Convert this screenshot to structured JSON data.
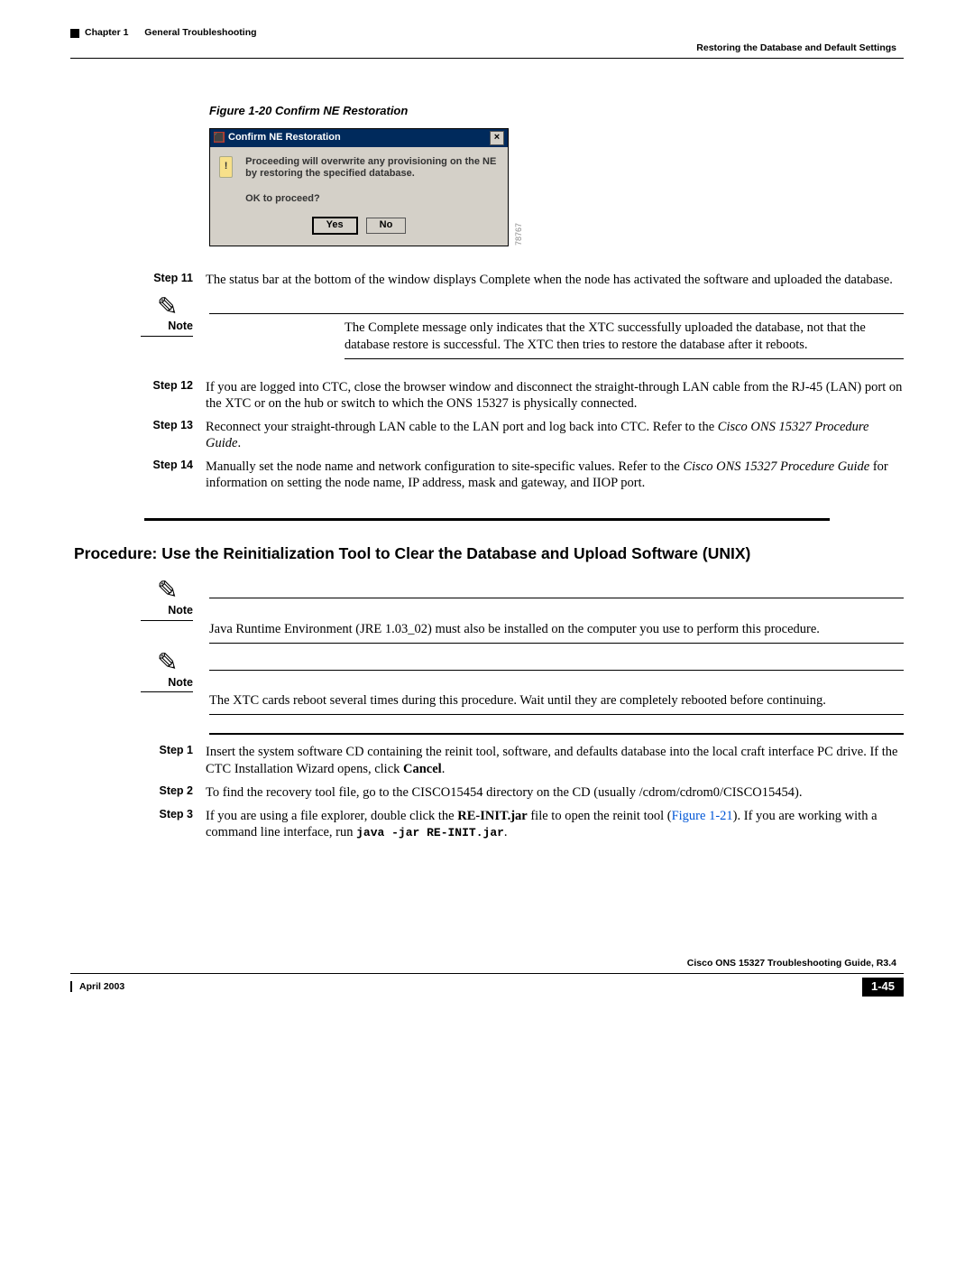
{
  "header": {
    "chapter_label": "Chapter 1",
    "chapter_title": "General Troubleshooting",
    "section": "Restoring the Database and Default Settings"
  },
  "figure": {
    "caption": "Figure 1-20   Confirm NE Restoration",
    "dialog_title": "Confirm NE Restoration",
    "dialog_msg1": "Proceeding will overwrite any provisioning on the NE by restoring the specified database.",
    "dialog_msg2": "OK to proceed?",
    "btn_yes": "Yes",
    "btn_no": "No",
    "close_label": "×",
    "refno": "78767"
  },
  "steps_a": {
    "s11_label": "Step 11",
    "s11_text": "The status bar at the bottom of the window displays Complete when the node has activated the software and uploaded the database.",
    "note1_label": "Note",
    "note1_text": "The Complete message only indicates that the XTC successfully uploaded the database, not that the database restore is successful. The XTC then tries to restore the database after it reboots.",
    "s12_label": "Step 12",
    "s12_text": "If you are logged into CTC, close the browser window and disconnect the straight-through LAN cable from the RJ-45 (LAN) port on the XTC or on the hub or switch to which the ONS 15327 is physically connected.",
    "s13_label": "Step 13",
    "s13_text_a": "Reconnect your straight-through LAN cable to the LAN port and log back into CTC. Refer to the ",
    "s13_text_ital": "Cisco ONS 15327 Procedure Guide",
    "s14_label": "Step 14",
    "s14_text_a": "Manually set the node name and network configuration to site-specific values. Refer to the ",
    "s14_text_ital": "Cisco ONS 15327 Procedure Guide",
    "s14_text_b": " for information on setting the node name, IP address, mask and gateway, and IIOP port."
  },
  "procedure": {
    "title": "Procedure: Use the Reinitialization Tool to Clear the Database and Upload Software (UNIX)",
    "note1_label": "Note",
    "note1_text": "Java Runtime Environment (JRE 1.03_02) must also be installed on the computer you use to perform this procedure.",
    "note2_label": "Note",
    "note2_text": "The XTC cards reboot several times during this procedure. Wait until they are completely rebooted before continuing.",
    "s1_label": "Step 1",
    "s1_text_a": "Insert the system software CD containing the reinit tool, software, and defaults database into the local craft interface PC drive. If the CTC Installation Wizard opens, click ",
    "s1_text_bold": "Cancel",
    "s2_label": "Step 2",
    "s2_text": "To find the recovery tool file, go to the CISCO15454 directory on the CD (usually /cdrom/cdrom0/CISCO15454).",
    "s3_label": "Step 3",
    "s3_text_a": "If you are using a file explorer, double click the ",
    "s3_text_bold": "RE-INIT.jar",
    "s3_text_b": " file to open the reinit tool (",
    "s3_link": "Figure 1-21",
    "s3_text_c": "). If you are working with a command line interface, run ",
    "s3_code": "java -jar RE-INIT.jar",
    "s3_text_d": "."
  },
  "footer": {
    "doc": "Cisco ONS 15327 Troubleshooting Guide, R3.4",
    "date": "April 2003",
    "page": "1-45"
  }
}
